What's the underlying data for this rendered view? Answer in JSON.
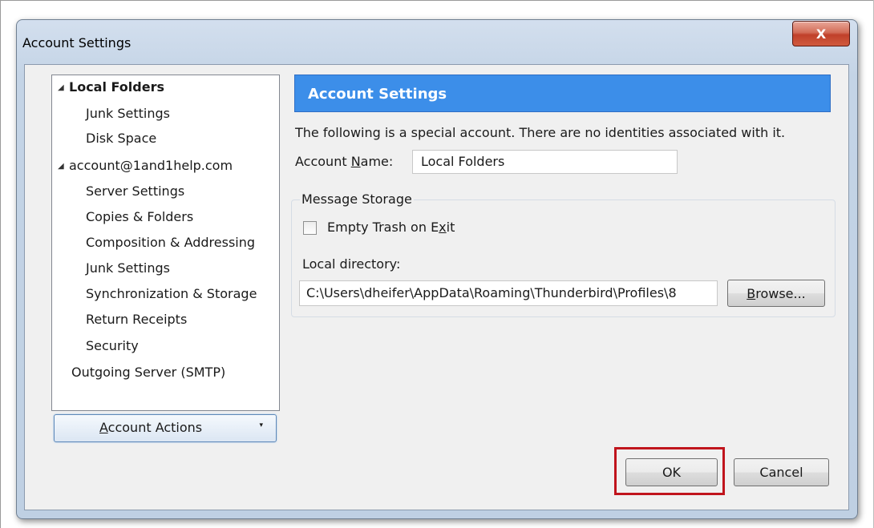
{
  "window": {
    "title": "Account Settings",
    "close_glyph": "X"
  },
  "tree": {
    "items": [
      {
        "label": "Local Folders",
        "icon": "collapse-arrow-icon"
      },
      {
        "label": "Junk Settings"
      },
      {
        "label": "Disk Space"
      },
      {
        "label": "account@1and1help.com",
        "icon": "collapse-arrow-icon"
      },
      {
        "label": "Server Settings"
      },
      {
        "label": "Copies & Folders"
      },
      {
        "label": "Composition & Addressing"
      },
      {
        "label": "Junk Settings"
      },
      {
        "label": "Synchronization & Storage"
      },
      {
        "label": "Return Receipts"
      },
      {
        "label": "Security"
      },
      {
        "label": "Outgoing Server (SMTP)"
      }
    ],
    "selected": "Local Folders"
  },
  "account_actions": {
    "label_pre": "",
    "label_key": "A",
    "label_post": "ccount Actions",
    "dropdown_glyph": "▾"
  },
  "panel": {
    "banner_title": "Account Settings",
    "note": "The following is a special account. There are no identities associated with it.",
    "account_name_pre": "Account ",
    "account_name_key": "N",
    "account_name_post": "ame:",
    "account_name_value": "Local Folders",
    "storage": {
      "legend": "Message Storage",
      "empty_trash_pre": "Empty Trash on E",
      "empty_trash_key": "x",
      "empty_trash_post": "it",
      "empty_trash_checked": false,
      "local_dir_label": "Local directory:",
      "local_dir_value": "C:\\Users\\dheifer\\AppData\\Roaming\\Thunderbird\\Profiles\\8",
      "browse_key": "B",
      "browse_post": "rowse..."
    }
  },
  "footer": {
    "ok_label": "OK",
    "cancel_label": "Cancel",
    "highlight_color": "#c0141c"
  },
  "colors": {
    "banner": "#3c8ee9",
    "window_frame": "#c4d4e6"
  }
}
